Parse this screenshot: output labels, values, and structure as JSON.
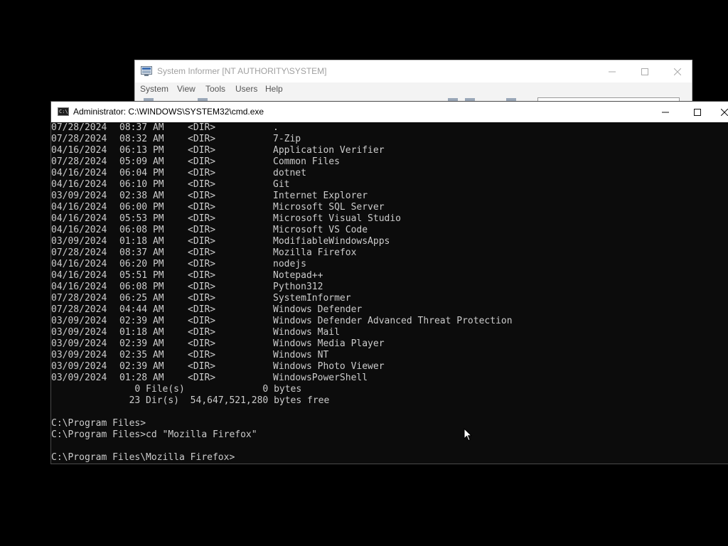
{
  "background_window": {
    "title": "System Informer [NT AUTHORITY\\SYSTEM]",
    "menu": [
      "System",
      "View",
      "Tools",
      "Users",
      "Help"
    ]
  },
  "cmd": {
    "title": "Administrator: C:\\WINDOWS\\SYSTEM32\\cmd.exe",
    "icon_text": "C:\\",
    "listing": [
      {
        "date": "07/28/2024",
        "time": "08:37 AM",
        "tag": "<DIR>",
        "name": "."
      },
      {
        "date": "07/28/2024",
        "time": "08:32 AM",
        "tag": "<DIR>",
        "name": "7-Zip"
      },
      {
        "date": "04/16/2024",
        "time": "06:13 PM",
        "tag": "<DIR>",
        "name": "Application Verifier"
      },
      {
        "date": "07/28/2024",
        "time": "05:09 AM",
        "tag": "<DIR>",
        "name": "Common Files"
      },
      {
        "date": "04/16/2024",
        "time": "06:04 PM",
        "tag": "<DIR>",
        "name": "dotnet"
      },
      {
        "date": "04/16/2024",
        "time": "06:10 PM",
        "tag": "<DIR>",
        "name": "Git"
      },
      {
        "date": "03/09/2024",
        "time": "02:38 AM",
        "tag": "<DIR>",
        "name": "Internet Explorer"
      },
      {
        "date": "04/16/2024",
        "time": "06:00 PM",
        "tag": "<DIR>",
        "name": "Microsoft SQL Server"
      },
      {
        "date": "04/16/2024",
        "time": "05:53 PM",
        "tag": "<DIR>",
        "name": "Microsoft Visual Studio"
      },
      {
        "date": "04/16/2024",
        "time": "06:08 PM",
        "tag": "<DIR>",
        "name": "Microsoft VS Code"
      },
      {
        "date": "03/09/2024",
        "time": "01:18 AM",
        "tag": "<DIR>",
        "name": "ModifiableWindowsApps"
      },
      {
        "date": "07/28/2024",
        "time": "08:37 AM",
        "tag": "<DIR>",
        "name": "Mozilla Firefox"
      },
      {
        "date": "04/16/2024",
        "time": "06:20 PM",
        "tag": "<DIR>",
        "name": "nodejs"
      },
      {
        "date": "04/16/2024",
        "time": "05:51 PM",
        "tag": "<DIR>",
        "name": "Notepad++"
      },
      {
        "date": "04/16/2024",
        "time": "06:08 PM",
        "tag": "<DIR>",
        "name": "Python312"
      },
      {
        "date": "07/28/2024",
        "time": "06:25 AM",
        "tag": "<DIR>",
        "name": "SystemInformer"
      },
      {
        "date": "07/28/2024",
        "time": "04:44 AM",
        "tag": "<DIR>",
        "name": "Windows Defender"
      },
      {
        "date": "03/09/2024",
        "time": "02:39 AM",
        "tag": "<DIR>",
        "name": "Windows Defender Advanced Threat Protection"
      },
      {
        "date": "03/09/2024",
        "time": "01:18 AM",
        "tag": "<DIR>",
        "name": "Windows Mail"
      },
      {
        "date": "03/09/2024",
        "time": "02:39 AM",
        "tag": "<DIR>",
        "name": "Windows Media Player"
      },
      {
        "date": "03/09/2024",
        "time": "02:35 AM",
        "tag": "<DIR>",
        "name": "Windows NT"
      },
      {
        "date": "03/09/2024",
        "time": "02:39 AM",
        "tag": "<DIR>",
        "name": "Windows Photo Viewer"
      },
      {
        "date": "03/09/2024",
        "time": "01:28 AM",
        "tag": "<DIR>",
        "name": "WindowsPowerShell"
      }
    ],
    "summary_files": "               0 File(s)              0 bytes",
    "summary_dirs": "              23 Dir(s)  54,647,521,280 bytes free",
    "prompt1": "C:\\Program Files>",
    "prompt2": "C:\\Program Files>cd \"Mozilla Firefox\"",
    "prompt3": "C:\\Program Files\\Mozilla Firefox>"
  },
  "colors": {
    "console_bg": "#0c0c0c",
    "console_text": "#cccccc",
    "titlebar_bg": "#ffffff"
  }
}
